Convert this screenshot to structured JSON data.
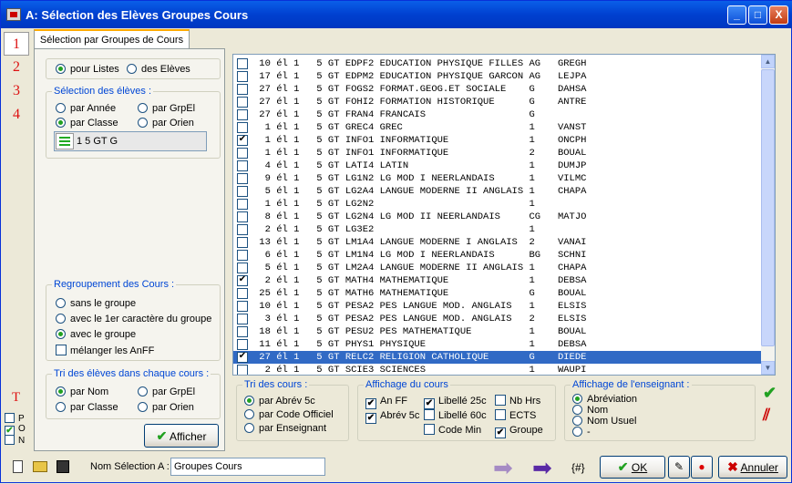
{
  "window": {
    "title": "A: Sélection des Elèves Groupes Cours",
    "min": "_",
    "max": "□",
    "close": "X"
  },
  "left_numbers": [
    "1",
    "2",
    "3",
    "4"
  ],
  "tab": {
    "label": "Sélection par Groupes de Cours"
  },
  "list_mode": {
    "options": [
      "pour Listes",
      "des Elèves"
    ],
    "selected": 0
  },
  "selection_eleves": {
    "legend": "Sélection des élèves :",
    "options": [
      "par Année",
      "par GrpEl",
      "par Classe",
      "par Orien"
    ],
    "selected": 2,
    "class_value": "1 5 GT G"
  },
  "regroupement": {
    "legend": "Regroupement des Cours :",
    "options": [
      "sans le groupe",
      "avec le 1er caractère du groupe",
      "avec le groupe"
    ],
    "selected": 2,
    "checkbox": "mélanger les AnFF"
  },
  "tri_eleves": {
    "legend": "Tri des élèves dans chaque cours :",
    "options": [
      "par Nom",
      "par GrpEl",
      "par Classe",
      "par Orien"
    ],
    "selected": 0
  },
  "afficher_button": "Afficher",
  "rows": [
    {
      "checked": false,
      "text": " 10 él 1   5 GT EDPF2 EDUCATION PHYSIQUE FILLES AG   GREGH"
    },
    {
      "checked": false,
      "text": " 17 él 1   5 GT EDPM2 EDUCATION PHYSIQUE GARCON AG   LEJPA"
    },
    {
      "checked": false,
      "text": " 27 él 1   5 GT FOGS2 FORMAT.GEOG.ET SOCIALE    G    DAHSA"
    },
    {
      "checked": false,
      "text": " 27 él 1   5 GT FOHI2 FORMATION HISTORIQUE      G    ANTRE"
    },
    {
      "checked": false,
      "text": " 27 él 1   5 GT FRAN4 FRANCAIS                  G"
    },
    {
      "checked": false,
      "text": "  1 él 1   5 GT GREC4 GREC                      1    VANST"
    },
    {
      "checked": true,
      "text": "  1 él 1   5 GT INFO1 INFORMATIQUE              1    ONCPH"
    },
    {
      "checked": false,
      "text": "  1 él 1   5 GT INFO1 INFORMATIQUE              2    BOUAL"
    },
    {
      "checked": false,
      "text": "  4 él 1   5 GT LATI4 LATIN                     1    DUMJP"
    },
    {
      "checked": false,
      "text": "  9 él 1   5 GT LG1N2 LG MOD I NEERLANDAIS      1    VILMC"
    },
    {
      "checked": false,
      "text": "  5 él 1   5 GT LG2A4 LANGUE MODERNE II ANGLAIS 1    CHAPA"
    },
    {
      "checked": false,
      "text": "  1 él 1   5 GT LG2N2                           1"
    },
    {
      "checked": false,
      "text": "  8 él 1   5 GT LG2N4 LG MOD II NEERLANDAIS     CG   MATJO"
    },
    {
      "checked": false,
      "text": "  2 él 1   5 GT LG3E2                           1"
    },
    {
      "checked": false,
      "text": " 13 él 1   5 GT LM1A4 LANGUE MODERNE I ANGLAIS  2    VANAI"
    },
    {
      "checked": false,
      "text": "  6 él 1   5 GT LM1N4 LG MOD I NEERLANDAIS      BG   SCHNI"
    },
    {
      "checked": false,
      "text": "  5 él 1   5 GT LM2A4 LANGUE MODERNE II ANGLAIS 1    CHAPA"
    },
    {
      "checked": true,
      "text": "  2 él 1   5 GT MATH4 MATHEMATIQUE              1    DEBSA"
    },
    {
      "checked": false,
      "text": " 25 él 1   5 GT MATH6 MATHEMATIQUE              G    BOUAL"
    },
    {
      "checked": false,
      "text": " 10 él 1   5 GT PESA2 PES LANGUE MOD. ANGLAIS   1    ELSIS"
    },
    {
      "checked": false,
      "text": "  3 él 1   5 GT PESA2 PES LANGUE MOD. ANGLAIS   2    ELSIS"
    },
    {
      "checked": false,
      "text": " 18 él 1   5 GT PESU2 PES MATHEMATIQUE          1    BOUAL"
    },
    {
      "checked": false,
      "text": " 11 él 1   5 GT PHYS1 PHYSIQUE                  1    DEBSA"
    },
    {
      "checked": true,
      "text": " 27 él 1   5 GT RELC2 RELIGION CATHOLIQUE       G    DIEDE",
      "selected": true
    },
    {
      "checked": false,
      "text": "  2 él 1   5 GT SCIE3 SCIENCES                  1    WAUPI"
    }
  ],
  "tri_cours": {
    "legend": "Tri des cours :",
    "options": [
      "par Abrév 5c",
      "par Code Officiel",
      "par Enseignant"
    ],
    "selected": 0
  },
  "affichage_cours": {
    "legend": "Affichage du cours",
    "items": [
      {
        "label": "An FF",
        "checked": true
      },
      {
        "label": "Libellé 25c",
        "checked": true
      },
      {
        "label": "Nb Hrs",
        "checked": false
      },
      {
        "label": "Abrév 5c",
        "checked": true
      },
      {
        "label": "Libellé 60c",
        "checked": false
      },
      {
        "label": "ECTS",
        "checked": false
      },
      {
        "label": "Code Min",
        "checked": false
      },
      {
        "label": "Groupe",
        "checked": true
      }
    ]
  },
  "affichage_enseignant": {
    "legend": "Affichage de l'enseignant :",
    "options": [
      "Abréviation",
      "Nom",
      "Nom Usuel",
      "-"
    ],
    "selected": 0
  },
  "left_bottom": {
    "t_label": "T",
    "options": [
      {
        "label": "P",
        "checked": false
      },
      {
        "label": "O",
        "checked": true
      },
      {
        "label": "N",
        "checked": false
      }
    ]
  },
  "footer": {
    "name_label": "Nom Sélection A :",
    "name_value": "Groupes Cours",
    "hash_label": "{#}",
    "ok_label": "OK",
    "cancel_label": "Annuler"
  },
  "colors": {
    "title": "#0040d0",
    "accent": "#316ac5",
    "legend": "#0046d5",
    "check_green": "#21a121",
    "number_red": "#d11"
  }
}
